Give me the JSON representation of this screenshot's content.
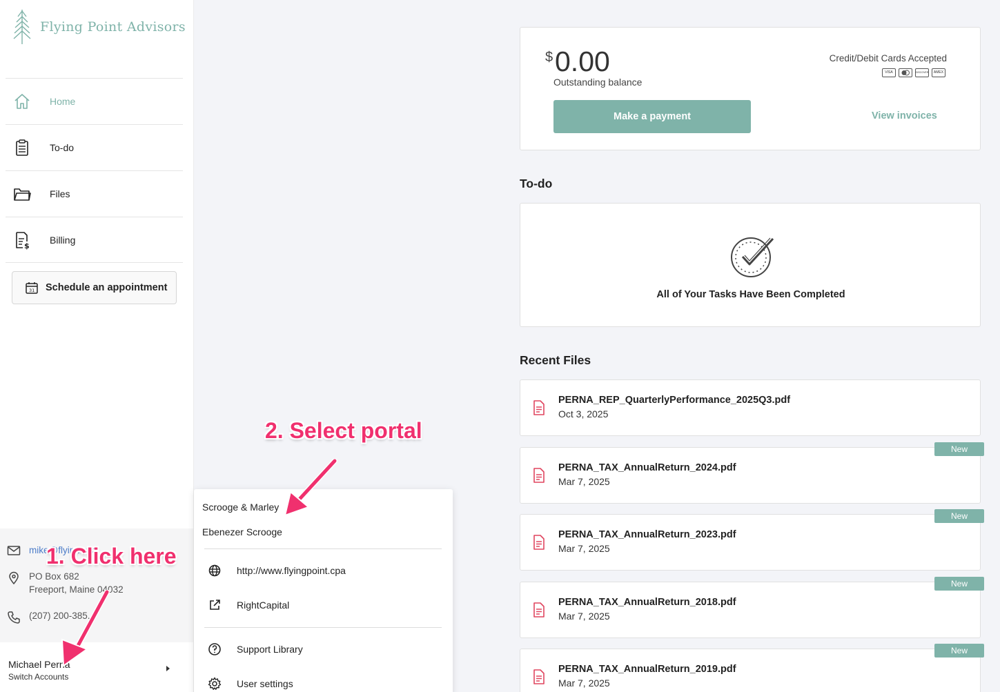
{
  "brand": {
    "name": "Flying Point Advisors"
  },
  "nav": [
    {
      "label": "Home",
      "icon": "home-icon"
    },
    {
      "label": "To-do",
      "icon": "clipboard-icon"
    },
    {
      "label": "Files",
      "icon": "folder-icon"
    },
    {
      "label": "Billing",
      "icon": "billing-icon"
    }
  ],
  "schedule": {
    "label": "Schedule an appointment"
  },
  "contact": {
    "email": "mike@flyin...cpa",
    "address_line1": "PO Box 682",
    "address_line2": "Freeport, Maine 04032",
    "phone": "(207) 200-385..."
  },
  "account": {
    "name": "Michael Perna",
    "switch_label": "Switch Accounts"
  },
  "popup": {
    "portals": [
      "Scrooge & Marley",
      "Ebenezer Scrooge"
    ],
    "website": "http://www.flyingpoint.cpa",
    "rightcapital": "RightCapital",
    "support": "Support Library",
    "settings": "User settings"
  },
  "balance": {
    "currency": "$",
    "amount": "0.00",
    "label": "Outstanding balance",
    "cards_accepted": "Credit/Debit Cards Accepted",
    "card_types": [
      "VISA",
      "MC",
      "DISCOVER",
      "AMEX"
    ],
    "pay_button": "Make a payment",
    "invoices_link": "View invoices"
  },
  "todo": {
    "title": "To-do",
    "message": "All of Your Tasks Have Been Completed"
  },
  "recent_files": {
    "title": "Recent Files",
    "new_label": "New",
    "files": [
      {
        "name": "PERNA_REP_QuarterlyPerformance_2025Q3.pdf",
        "date": "Oct 3, 2025",
        "is_new": false
      },
      {
        "name": "PERNA_TAX_AnnualReturn_2024.pdf",
        "date": "Mar 7, 2025",
        "is_new": true
      },
      {
        "name": "PERNA_TAX_AnnualReturn_2023.pdf",
        "date": "Mar 7, 2025",
        "is_new": true
      },
      {
        "name": "PERNA_TAX_AnnualReturn_2018.pdf",
        "date": "Mar 7, 2025",
        "is_new": true
      },
      {
        "name": "PERNA_TAX_AnnualReturn_2019.pdf",
        "date": "Mar 7, 2025",
        "is_new": true
      }
    ]
  },
  "annotations": {
    "step1": "1. Click here",
    "step2": "2. Select portal",
    "color": "#f0306e"
  },
  "colors": {
    "accent": "#7fb3a9",
    "file_icon": "#e0455f",
    "link": "#4a7bc8"
  }
}
